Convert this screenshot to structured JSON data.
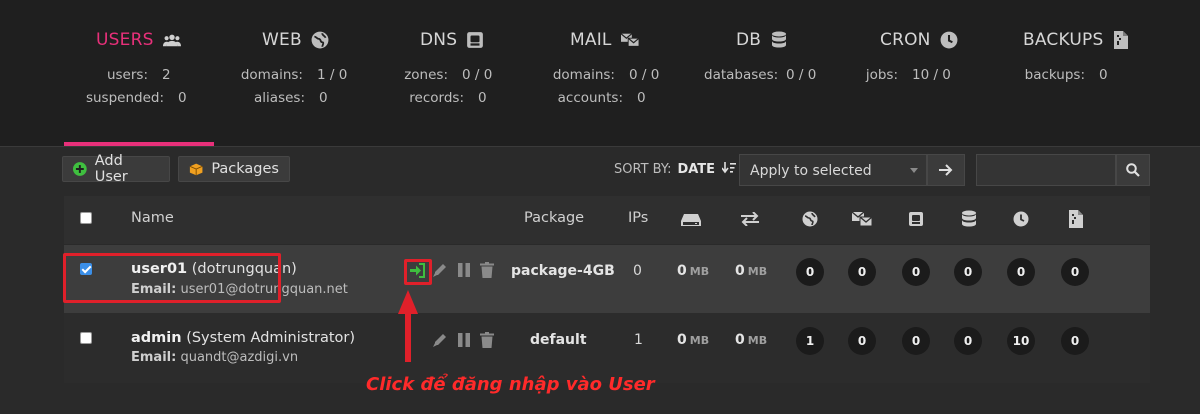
{
  "stats": [
    {
      "title": "USERS",
      "icon": "users-icon",
      "rows": [
        [
          "users:",
          "2"
        ],
        [
          "suspended:",
          "0"
        ]
      ]
    },
    {
      "title": "WEB",
      "icon": "globe-icon",
      "rows": [
        [
          "domains:",
          "1 / 0"
        ],
        [
          "aliases:",
          "0"
        ]
      ]
    },
    {
      "title": "DNS",
      "icon": "dns-icon",
      "rows": [
        [
          "zones:",
          "0 / 0"
        ],
        [
          "records:",
          "0"
        ]
      ]
    },
    {
      "title": "MAIL",
      "icon": "mail-icon",
      "rows": [
        [
          "domains:",
          "0 / 0"
        ],
        [
          "accounts:",
          "0"
        ]
      ]
    },
    {
      "title": "DB",
      "icon": "database-icon",
      "rows": [
        [
          "databases:",
          "0 / 0"
        ]
      ]
    },
    {
      "title": "CRON",
      "icon": "clock-icon",
      "rows": [
        [
          "jobs:",
          "10 / 0"
        ]
      ]
    },
    {
      "title": "BACKUPS",
      "icon": "file-icon",
      "rows": [
        [
          "backups:",
          "0"
        ]
      ]
    }
  ],
  "toolbar": {
    "add_user": "Add User",
    "packages": "Packages",
    "sort_by": "SORT BY:",
    "sort_value": "DATE",
    "apply_selected": "Apply to selected"
  },
  "table": {
    "headers": {
      "name": "Name",
      "package": "Package",
      "ips": "IPs"
    },
    "rows": [
      {
        "username": "user01",
        "fullname": "(dotrungquan)",
        "email_label": "Email:",
        "email": "user01@dotrungquan.net",
        "package": "package-4GB",
        "ips": "0",
        "disk": "0",
        "bandwidth": "0",
        "unit": "MB",
        "counts": [
          "0",
          "0",
          "0",
          "0",
          "0",
          "0"
        ],
        "checked": true
      },
      {
        "username": "admin",
        "fullname": "(System Administrator)",
        "email_label": "Email:",
        "email": "quandt@azdigi.vn",
        "package": "default",
        "ips": "1",
        "disk": "0",
        "bandwidth": "0",
        "unit": "MB",
        "counts": [
          "1",
          "0",
          "0",
          "0",
          "10",
          "0"
        ],
        "checked": false
      }
    ]
  },
  "annotation": "Click để đăng nhập vào User",
  "colors": {
    "accent": "#e8307a",
    "annotation": "#e0202a",
    "login_icon": "#3fbf3f"
  }
}
